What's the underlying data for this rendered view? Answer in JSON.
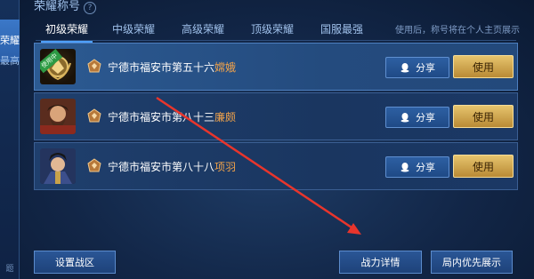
{
  "page": {
    "title": "荣耀称号"
  },
  "leftbar": {
    "active_tab": "荣耀",
    "sub_tab": "最高",
    "footer": "题"
  },
  "tabs": [
    {
      "label": "初级荣耀",
      "active": true
    },
    {
      "label": "中级荣耀",
      "active": false
    },
    {
      "label": "高级荣耀",
      "active": false
    },
    {
      "label": "顶级荣耀",
      "active": false
    },
    {
      "label": "国服最强",
      "active": false
    }
  ],
  "hint": "使用后，称号将在个人主页展示",
  "rows": [
    {
      "rank_prefix": "宁德市福安市第五十六",
      "hero": "嫦娥",
      "badge": "使用中",
      "share_label": "分享",
      "use_label": "使用"
    },
    {
      "rank_prefix": "宁德市福安市第八十三",
      "hero": "廉颇",
      "share_label": "分享",
      "use_label": "使用"
    },
    {
      "rank_prefix": "宁德市福安市第八十八",
      "hero": "项羽",
      "share_label": "分享",
      "use_label": "使用"
    }
  ],
  "bottom": {
    "set_region": "设置战区",
    "battle_detail": "战力详情",
    "priority_show": "局内优先展示"
  },
  "colors": {
    "accent_gold": "#e6c46d",
    "hero_name": "#f0a24a",
    "annotation_arrow": "#e8352c"
  }
}
